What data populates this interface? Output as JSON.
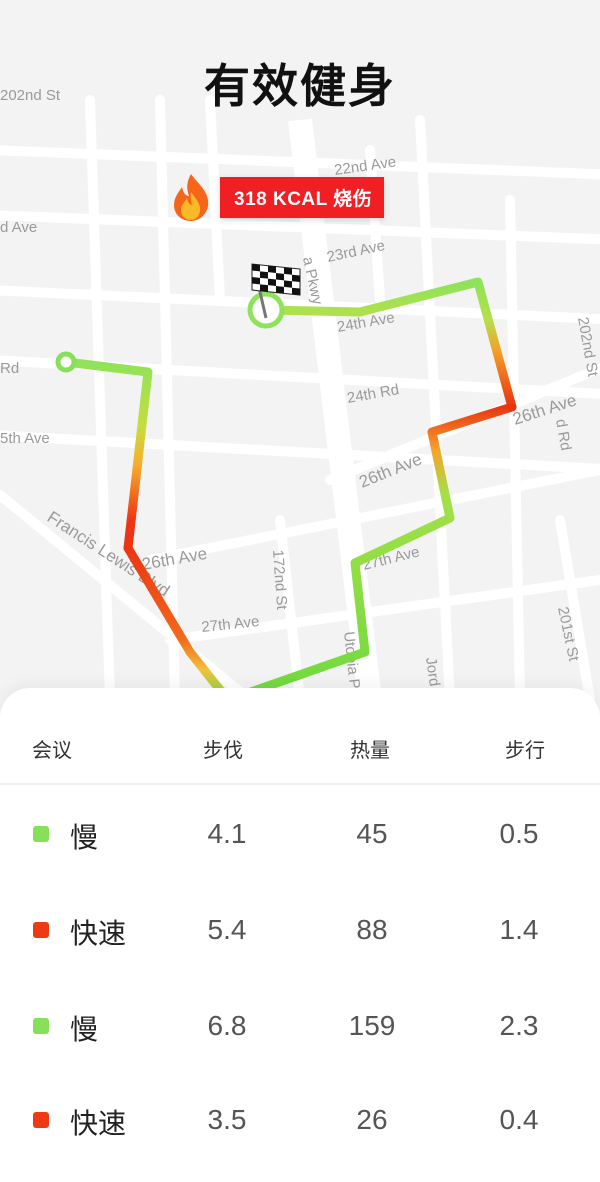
{
  "title": "有效健身",
  "kcal_badge": "318 KCAL 烧伤",
  "map": {
    "streets": [
      "22nd Ave",
      "23rd Ave",
      "24th Ave",
      "24th Rd",
      "26th Ave",
      "26th Ave",
      "27th Ave",
      "27th Ave",
      "Francis Lewis Blvd",
      "172nd St",
      "202nd St",
      "201st St",
      "Jord",
      "Utopia Pkwy",
      "d Ave",
      "Rd",
      "5th Ave",
      "a Pkwy",
      "202nd St",
      "d Rd"
    ]
  },
  "table": {
    "headers": [
      "会议",
      "步伐",
      "热量",
      "步行"
    ],
    "rows": [
      {
        "label": "慢",
        "pace": "4.1",
        "calories": "45",
        "walk": "0.5",
        "color": "#86e05a"
      },
      {
        "label": "快速",
        "pace": "5.4",
        "calories": "88",
        "walk": "1.4",
        "color": "#ee3a12"
      },
      {
        "label": "慢",
        "pace": "6.8",
        "calories": "159",
        "walk": "2.3",
        "color": "#86e05a"
      },
      {
        "label": "快速",
        "pace": "3.5",
        "calories": "26",
        "walk": "0.4",
        "color": "#ee3a12"
      }
    ]
  }
}
